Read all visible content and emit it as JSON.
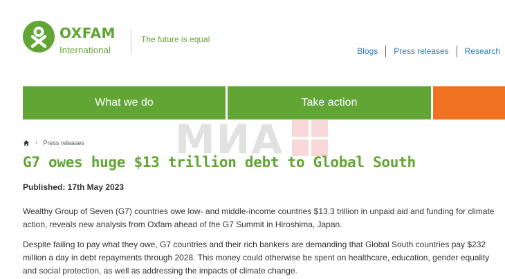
{
  "brand": {
    "name": "OXFAM",
    "sub": "International",
    "tagline": "The future is equal",
    "color": "#61a534"
  },
  "utility_nav": [
    {
      "label": "Blogs"
    },
    {
      "label": "Press releases"
    },
    {
      "label": "Research"
    }
  ],
  "main_nav": {
    "what": "What we do",
    "take": "Take action",
    "orange_color": "#f07121"
  },
  "watermark": "МИА",
  "breadcrumb": {
    "current": "Press releases"
  },
  "article": {
    "title": "G7 owes huge $13 trillion debt to Global South",
    "published": "Published: 17th May 2023",
    "p1": "Wealthy Group of Seven (G7) countries owe low- and middle-income countries $13.3 trillion in unpaid aid and funding for climate action, reveals new analysis from Oxfam ahead of the G7 Summit in Hiroshima, Japan.",
    "p2": "Despite failing to pay what they owe, G7 countries and their rich bankers are demanding that Global South countries pay $232 million a day in debt repayments through 2028. This money could otherwise be spent on healthcare, education, gender equality and social protection, as well as addressing the impacts of climate change."
  }
}
